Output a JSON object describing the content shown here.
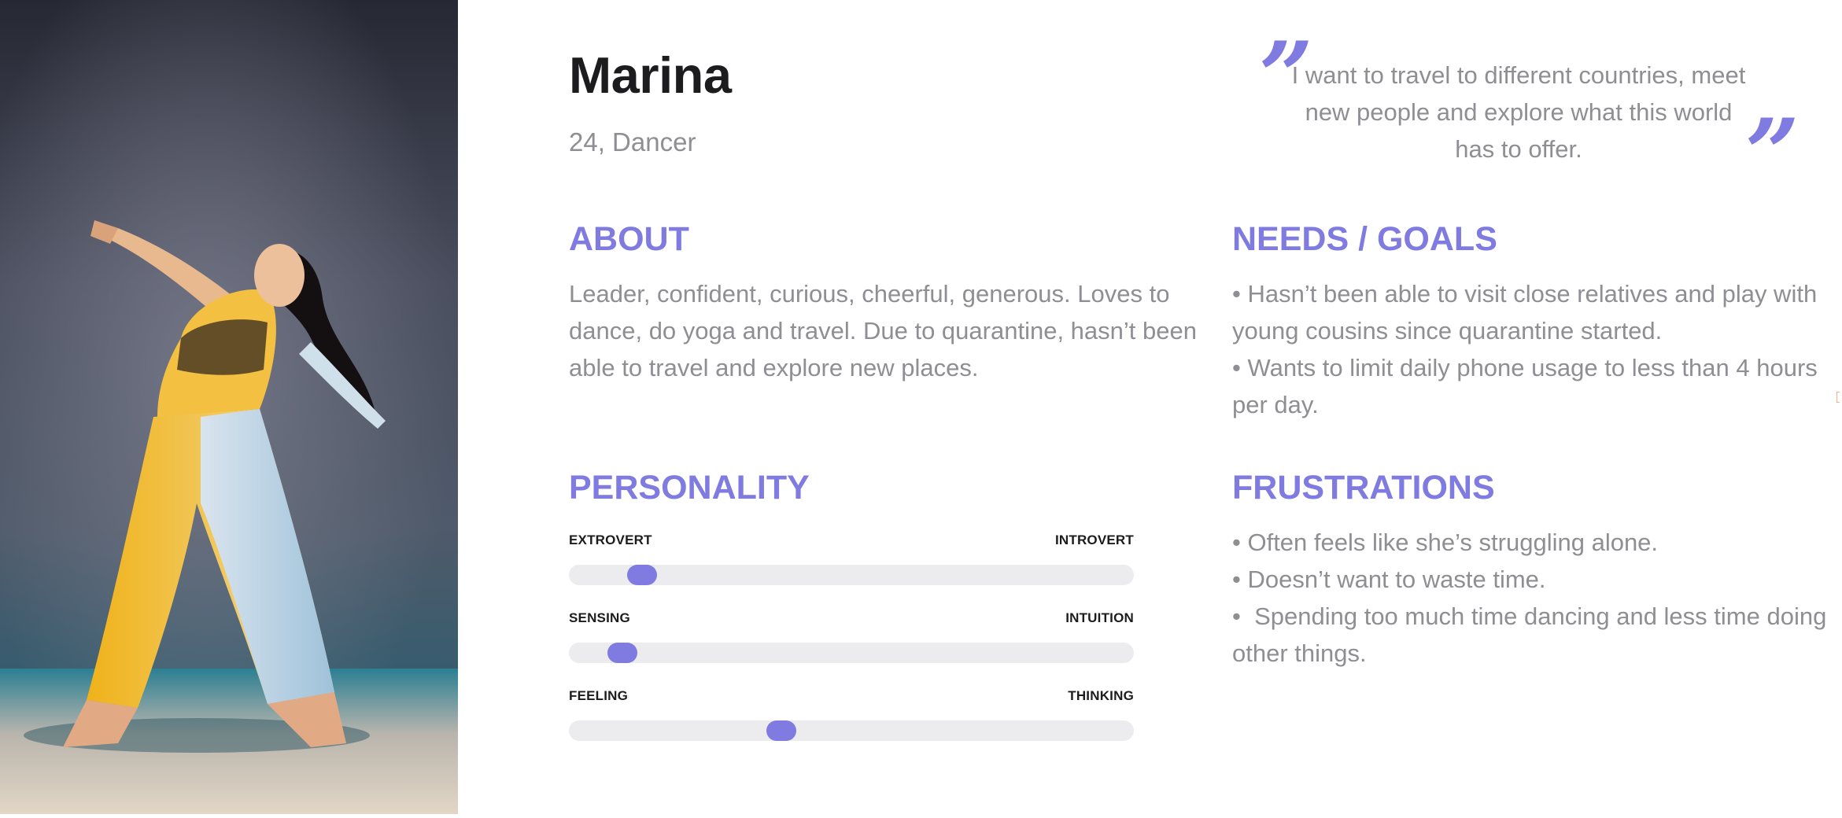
{
  "persona": {
    "name": "Marina",
    "age": "24,",
    "occupation": "Dancer",
    "photo_alt": "Marina"
  },
  "quote": {
    "open_mark": "”",
    "close_mark": "”",
    "text": "I want to travel to different countries, meet new people and explore what this world has to offer."
  },
  "about": {
    "heading": "ABOUT",
    "text": "Leader, confident, curious, cheerful, generous. Loves to dance, do yoga and travel. Due to quarantine, hasn’t been able to travel and explore new places."
  },
  "needs": {
    "heading": "NEEDS / GOALS",
    "items": [
      "Hasn’t been able to visit close relatives and play with young cousins since quarantine started.",
      "Wants to limit daily phone usage to less than 4 hours per day."
    ]
  },
  "personality": {
    "heading": "PERSONALITY",
    "traits": [
      {
        "left": "EXTROVERT",
        "right": "INTROVERT",
        "value": 0.13
      },
      {
        "left": "SENSING",
        "right": "INTUITION",
        "value": 0.095
      },
      {
        "left": "FEELING",
        "right": "THINKING",
        "value": 0.376
      }
    ]
  },
  "frustrations": {
    "heading": "FRUSTRATIONS",
    "items": [
      "Often feels like she’s struggling alone.",
      "Doesn’t want to waste time.",
      " Spending too much time dancing and less time doing other things."
    ]
  },
  "colors": {
    "accent": "#7f7be0",
    "text_muted": "#8e8e93",
    "text_dark": "#1c1c1e",
    "track": "#ececee"
  }
}
